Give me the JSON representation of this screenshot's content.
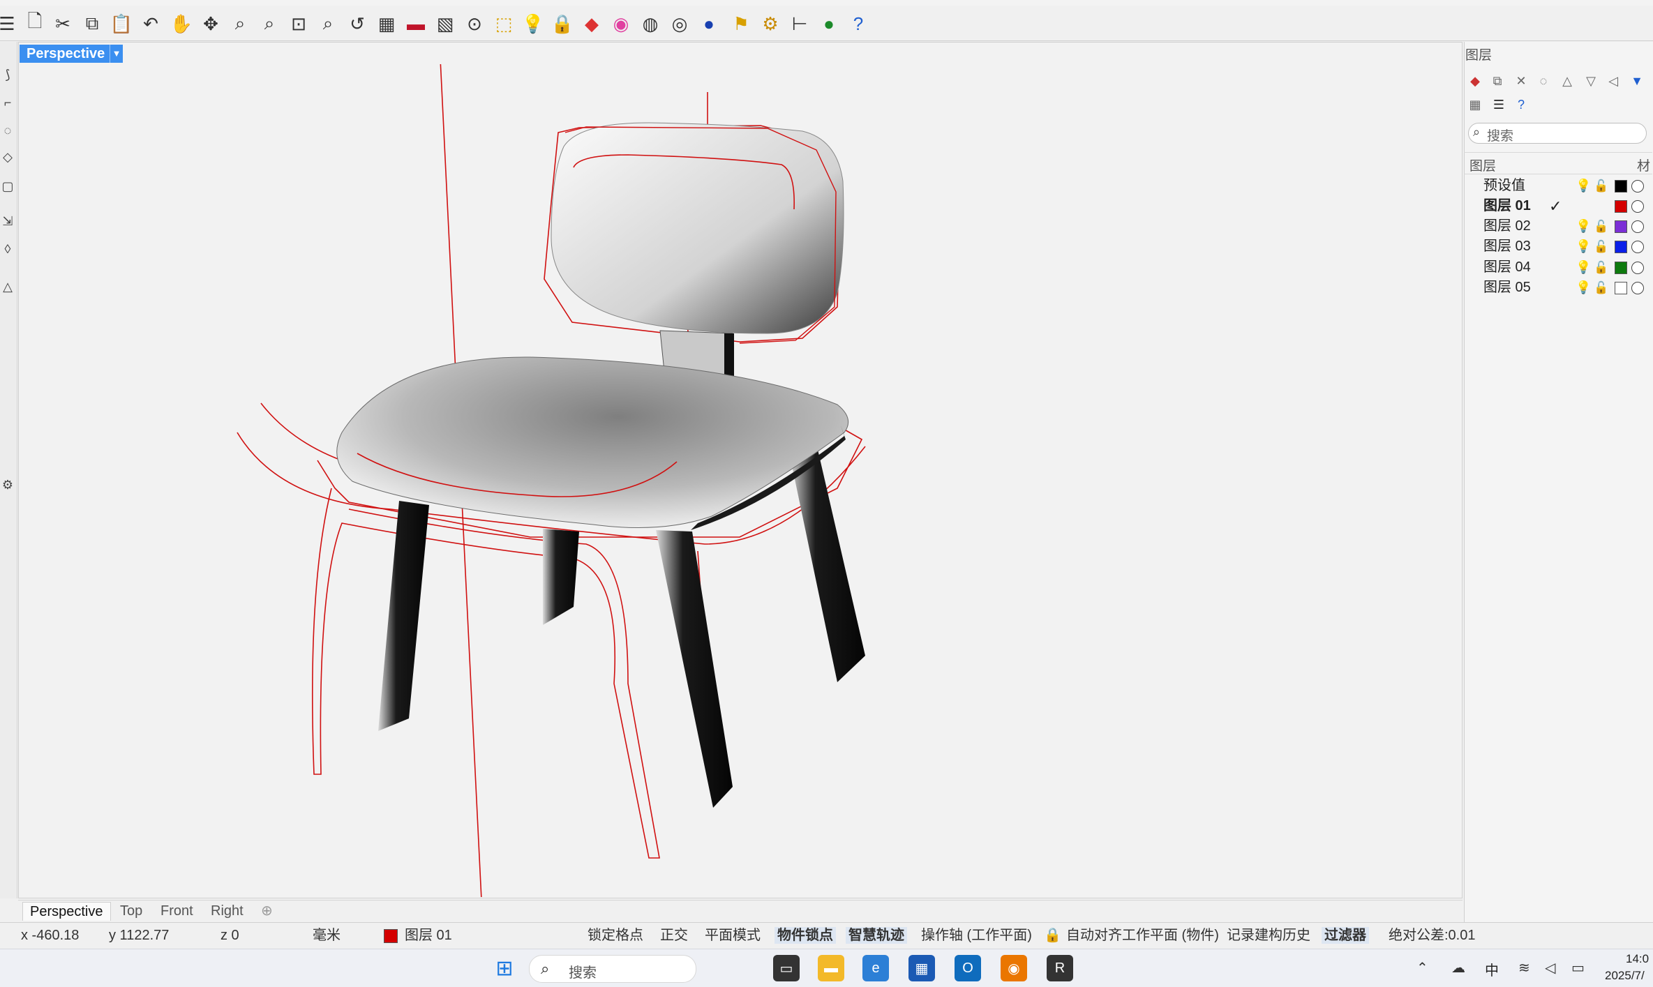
{
  "viewport": {
    "title": "Perspective",
    "tabs": [
      "Perspective",
      "Top",
      "Front",
      "Right"
    ],
    "add_tab_icon": "plus-icon"
  },
  "layers_panel": {
    "title": "图层",
    "search_placeholder": "搜索",
    "header_label": "图层",
    "header_material": "材",
    "layers": [
      {
        "name": "预设值",
        "current": false,
        "color": "#000000"
      },
      {
        "name": "图层 01",
        "current": true,
        "color": "#d40000"
      },
      {
        "name": "图层 02",
        "current": false,
        "color": "#7b2fd6"
      },
      {
        "name": "图层 03",
        "current": false,
        "color": "#0b1fe8"
      },
      {
        "name": "图层 04",
        "current": false,
        "color": "#0e7a0e"
      },
      {
        "name": "图层 05",
        "current": false,
        "color": "#ffffff"
      }
    ]
  },
  "status": {
    "x": "x -460.18",
    "y": "y 1122.77",
    "z": "z 0",
    "units": "毫米",
    "layer": "图层 01",
    "layer_color": "#d40000",
    "grid_snap": "锁定格点",
    "ortho": "正交",
    "planar": "平面模式",
    "osnap": "物件锁点",
    "smarttrack": "智慧轨迹",
    "gumball": "操作轴 (工作平面)",
    "autoalign": "自动对齐工作平面 (物件)",
    "history": "记录建构历史",
    "filter": "过滤器",
    "tolerance": "绝对公差:0.01"
  },
  "taskbar": {
    "search_placeholder": "搜索",
    "ime": "中",
    "time": "14:0",
    "date": "2025/7/"
  }
}
